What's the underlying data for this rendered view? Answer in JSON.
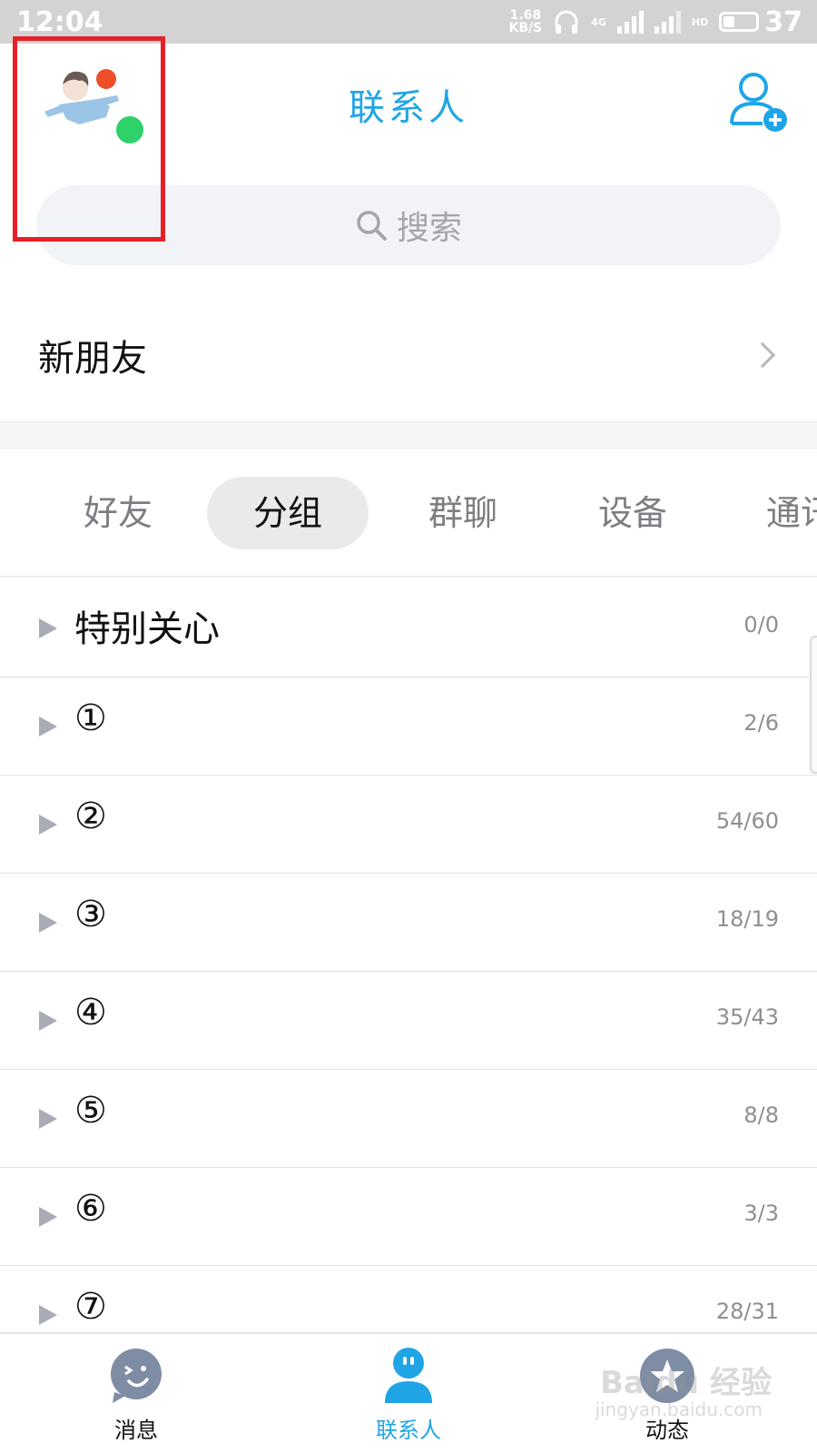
{
  "status_bar": {
    "time": "12:04",
    "speed_value": "1.68",
    "speed_unit": "KB/S",
    "network": "4G",
    "hd": "HD",
    "battery": "37"
  },
  "header": {
    "title": "联系人",
    "add_contact_icon": "add-user-icon"
  },
  "search": {
    "placeholder": "搜索",
    "icon": "search-icon"
  },
  "new_friends": {
    "label": "新朋友"
  },
  "tabs": [
    {
      "label": "好友",
      "active": false
    },
    {
      "label": "分组",
      "active": true
    },
    {
      "label": "群聊",
      "active": false
    },
    {
      "label": "设备",
      "active": false
    },
    {
      "label": "通讯",
      "active": false
    }
  ],
  "groups": [
    {
      "name": "特别关心",
      "count": "0/0"
    },
    {
      "name": "①",
      "count": "2/6"
    },
    {
      "name": "②",
      "count": "54/60"
    },
    {
      "name": "③",
      "count": "18/19"
    },
    {
      "name": "④",
      "count": "35/43"
    },
    {
      "name": "⑤",
      "count": "8/8"
    },
    {
      "name": "⑥",
      "count": "3/3"
    },
    {
      "name": "⑦",
      "count": "28/31"
    }
  ],
  "bottom_nav": [
    {
      "label": "消息",
      "icon": "message-icon",
      "active": false
    },
    {
      "label": "联系人",
      "icon": "contacts-icon",
      "active": true
    },
    {
      "label": "动态",
      "icon": "star-icon",
      "active": false
    }
  ],
  "watermark": {
    "text": "Baidu 经验",
    "sub": "jingyan.baidu.com"
  },
  "colors": {
    "accent": "#1fa5e6",
    "highlight_box": "#e62028",
    "status_bar_bg": "#d3d3d3"
  }
}
